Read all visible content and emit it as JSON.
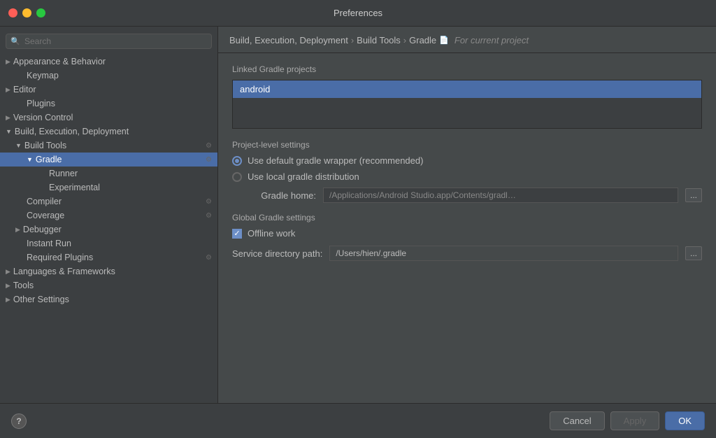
{
  "window": {
    "title": "Preferences",
    "controls": {
      "close": "close",
      "minimize": "minimize",
      "maximize": "maximize"
    }
  },
  "breadcrumb": {
    "parts": [
      "Build, Execution, Deployment",
      "Build Tools",
      "Gradle"
    ],
    "for_project_label": "For current project",
    "icon": "📄"
  },
  "sidebar": {
    "search_placeholder": "Search",
    "items": [
      {
        "id": "appearance",
        "label": "Appearance & Behavior",
        "level": 0,
        "hasArrow": true,
        "arrowOpen": false,
        "hasIcon": false
      },
      {
        "id": "keymap",
        "label": "Keymap",
        "level": 1,
        "hasArrow": false,
        "hasIcon": false
      },
      {
        "id": "editor",
        "label": "Editor",
        "level": 0,
        "hasArrow": true,
        "arrowOpen": false,
        "hasIcon": false
      },
      {
        "id": "plugins",
        "label": "Plugins",
        "level": 1,
        "hasArrow": false,
        "hasIcon": false
      },
      {
        "id": "version-control",
        "label": "Version Control",
        "level": 0,
        "hasArrow": true,
        "arrowOpen": false,
        "hasIcon": false
      },
      {
        "id": "build-execution",
        "label": "Build, Execution, Deployment",
        "level": 0,
        "hasArrow": true,
        "arrowOpen": true,
        "hasIcon": false
      },
      {
        "id": "build-tools",
        "label": "Build Tools",
        "level": 1,
        "hasArrow": true,
        "arrowOpen": true,
        "hasIcon": true
      },
      {
        "id": "gradle",
        "label": "Gradle",
        "level": 2,
        "hasArrow": true,
        "arrowOpen": true,
        "hasIcon": true,
        "selected": true
      },
      {
        "id": "runner",
        "label": "Runner",
        "level": 3,
        "hasArrow": false,
        "hasIcon": false
      },
      {
        "id": "experimental",
        "label": "Experimental",
        "level": 3,
        "hasArrow": false,
        "hasIcon": false
      },
      {
        "id": "compiler",
        "label": "Compiler",
        "level": 1,
        "hasArrow": false,
        "hasIcon": true
      },
      {
        "id": "coverage",
        "label": "Coverage",
        "level": 1,
        "hasArrow": false,
        "hasIcon": true
      },
      {
        "id": "debugger",
        "label": "Debugger",
        "level": 1,
        "hasArrow": true,
        "arrowOpen": false,
        "hasIcon": false
      },
      {
        "id": "instant-run",
        "label": "Instant Run",
        "level": 1,
        "hasArrow": false,
        "hasIcon": false
      },
      {
        "id": "required-plugins",
        "label": "Required Plugins",
        "level": 1,
        "hasArrow": false,
        "hasIcon": true
      },
      {
        "id": "languages",
        "label": "Languages & Frameworks",
        "level": 0,
        "hasArrow": true,
        "arrowOpen": false,
        "hasIcon": false
      },
      {
        "id": "tools",
        "label": "Tools",
        "level": 0,
        "hasArrow": true,
        "arrowOpen": false,
        "hasIcon": false
      },
      {
        "id": "other-settings",
        "label": "Other Settings",
        "level": 0,
        "hasArrow": true,
        "arrowOpen": false,
        "hasIcon": false
      }
    ]
  },
  "content": {
    "linked_gradle_section": "Linked Gradle projects",
    "linked_projects": [
      {
        "id": "android",
        "label": "android",
        "selected": true
      }
    ],
    "project_level_section": "Project-level settings",
    "radio_options": [
      {
        "id": "default-wrapper",
        "label": "Use default gradle wrapper (recommended)",
        "checked": true
      },
      {
        "id": "local-distribution",
        "label": "Use local gradle distribution",
        "checked": false
      }
    ],
    "gradle_home_label": "Gradle home:",
    "gradle_home_value": "/Applications/Android Studio.app/Contents/gradl…",
    "browse_label": "...",
    "global_gradle_section": "Global Gradle settings",
    "offline_work_label": "Offline work",
    "offline_work_checked": true,
    "service_dir_label": "Service directory path:",
    "service_dir_value": "/Users/hien/.gradle",
    "service_browse_label": "..."
  },
  "footer": {
    "help_label": "?",
    "cancel_label": "Cancel",
    "apply_label": "Apply",
    "ok_label": "OK"
  }
}
